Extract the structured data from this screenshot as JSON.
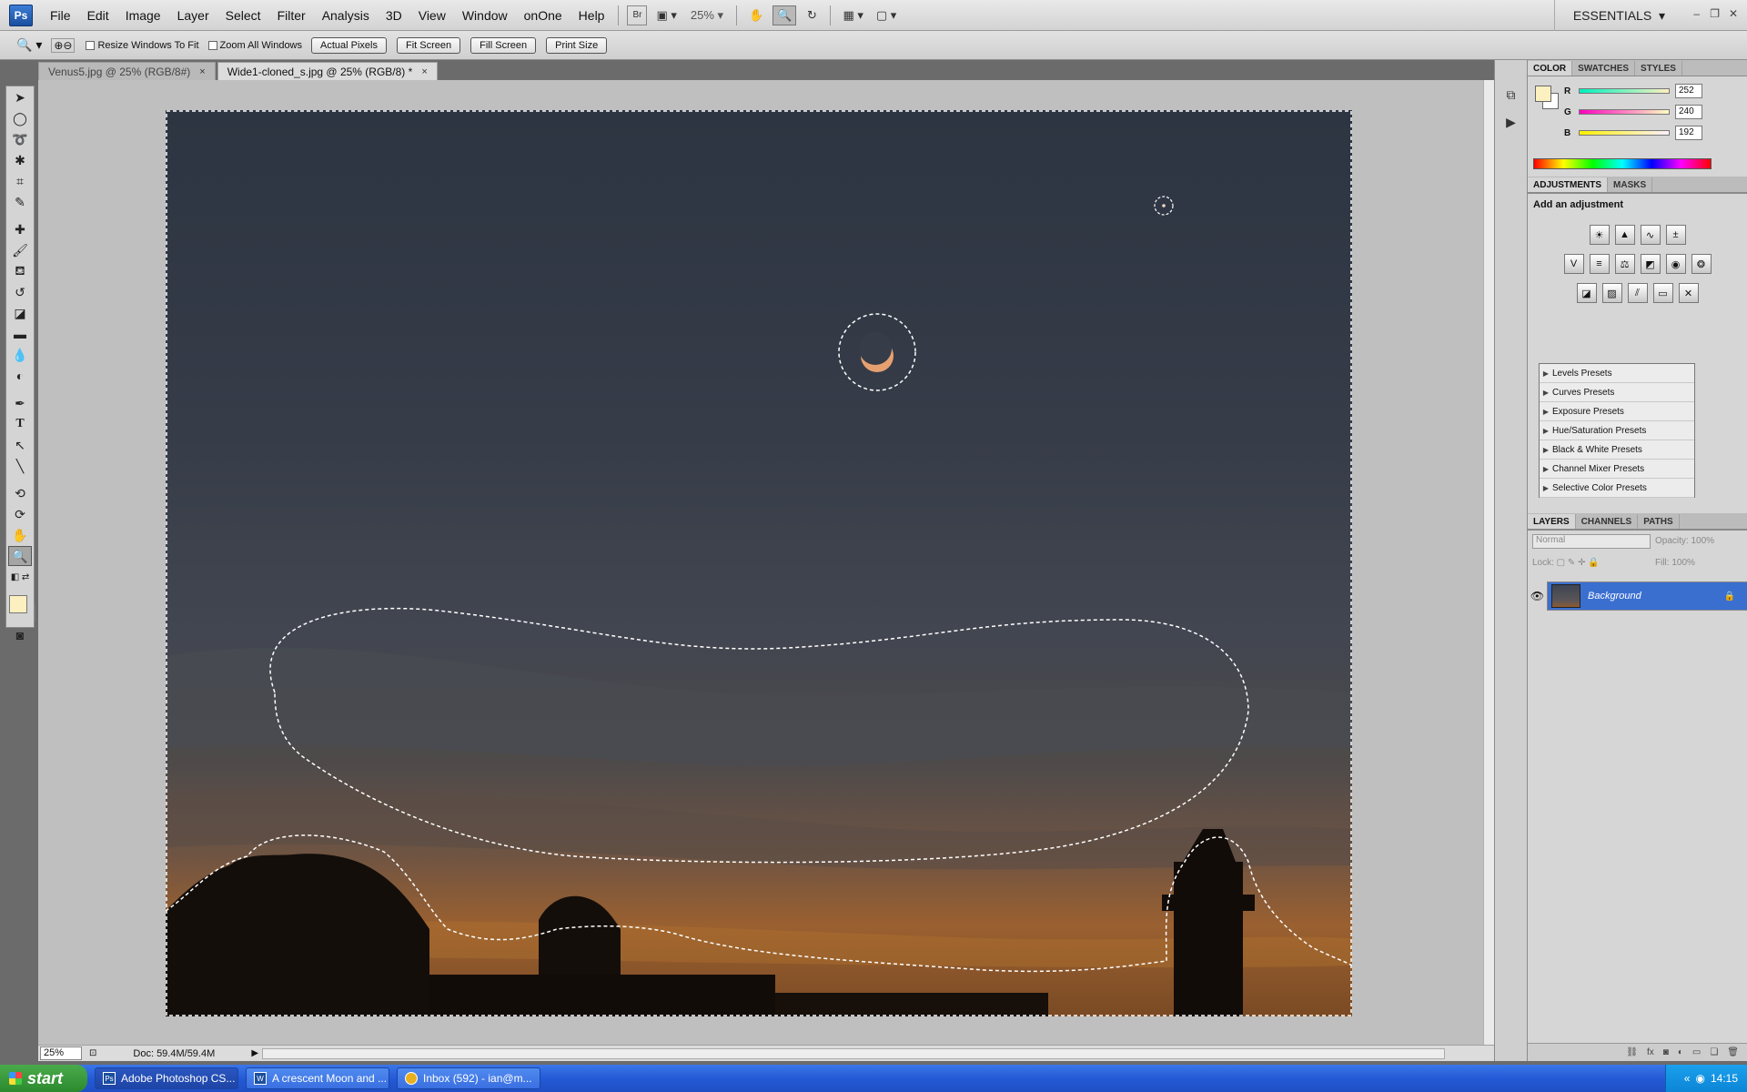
{
  "app": {
    "logo": "Ps",
    "workspace": "ESSENTIALS"
  },
  "menu": [
    "File",
    "Edit",
    "Image",
    "Layer",
    "Select",
    "Filter",
    "Analysis",
    "3D",
    "View",
    "Window",
    "onOne",
    "Help"
  ],
  "menubar": {
    "bridge": "Br",
    "zoom": "25%"
  },
  "options": {
    "resize_windows": "Resize Windows To Fit",
    "zoom_all": "Zoom All Windows",
    "actual_pixels": "Actual Pixels",
    "fit_screen": "Fit Screen",
    "fill_screen": "Fill Screen",
    "print_size": "Print Size"
  },
  "tabs": [
    {
      "label": "Venus5.jpg @ 25% (RGB/8#)",
      "close": "×"
    },
    {
      "label": "Wide1-cloned_s.jpg @ 25% (RGB/8) *",
      "close": "×"
    }
  ],
  "status": {
    "zoom": "25%",
    "doc": "Doc: 59.4M/59.4M"
  },
  "color_panel": {
    "tabs": [
      "COLOR",
      "SWATCHES",
      "STYLES"
    ],
    "r_label": "R",
    "r": "252",
    "g_label": "G",
    "g": "240",
    "b_label": "B",
    "b": "192",
    "foreground": "#fcf0c0"
  },
  "adjustments": {
    "tabs": [
      "ADJUSTMENTS",
      "MASKS"
    ],
    "title": "Add an adjustment",
    "presets": [
      "Levels Presets",
      "Curves Presets",
      "Exposure Presets",
      "Hue/Saturation Presets",
      "Black & White Presets",
      "Channel Mixer Presets",
      "Selective Color Presets"
    ]
  },
  "layers": {
    "tabs": [
      "LAYERS",
      "CHANNELS",
      "PATHS"
    ],
    "blend_mode": "Normal",
    "opacity_label": "Opacity:",
    "opacity": "100%",
    "lock_label": "Lock:",
    "fill_label": "Fill:",
    "fill": "100%",
    "layer_name": "Background"
  },
  "taskbar": {
    "start": "start",
    "items": [
      "Adobe Photoshop CS...",
      "A crescent Moon and ...",
      "Inbox (592) - ian@m..."
    ],
    "clock": "14:15"
  }
}
